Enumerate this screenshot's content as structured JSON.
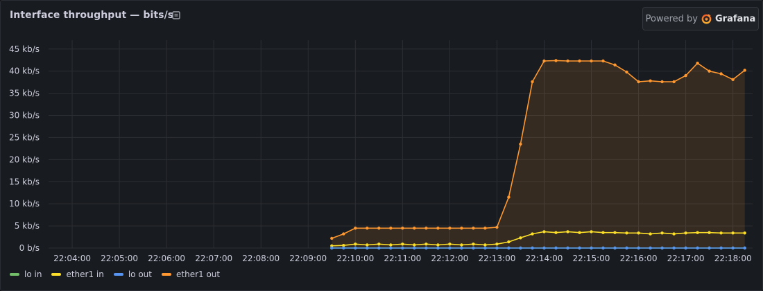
{
  "panel": {
    "title": "Interface throughput — bits/s",
    "badge_prefix": "Powered by",
    "badge_brand": "Grafana"
  },
  "colors": {
    "lo_in": "#73bf69",
    "ether1_in": "#fade2a",
    "lo_out": "#5794f2",
    "ether1_out": "#ff9830",
    "grid": "#2c2f35",
    "tick_text": "#ccccdc"
  },
  "chart_data": {
    "type": "line",
    "title": "Interface throughput — bits/s",
    "xlabel": "",
    "ylabel": "",
    "x_unit": "time",
    "x_range": [
      "22:03:30",
      "22:18:25"
    ],
    "ylim": [
      0,
      47
    ],
    "y_ticks": [
      "0 b/s",
      "5 kb/s",
      "10 kb/s",
      "15 kb/s",
      "20 kb/s",
      "25 kb/s",
      "30 kb/s",
      "35 kb/s",
      "40 kb/s",
      "45 kb/s"
    ],
    "x_ticks": [
      "22:04:00",
      "22:05:00",
      "22:06:00",
      "22:07:00",
      "22:08:00",
      "22:09:00",
      "22:10:00",
      "22:11:00",
      "22:12:00",
      "22:13:00",
      "22:14:00",
      "22:15:00",
      "22:16:00",
      "22:17:00",
      "22:18:00"
    ],
    "grid": true,
    "legend_position": "bottom-left",
    "x": [
      "22:09:30",
      "22:09:45",
      "22:10:00",
      "22:10:15",
      "22:10:30",
      "22:10:45",
      "22:11:00",
      "22:11:15",
      "22:11:30",
      "22:11:45",
      "22:12:00",
      "22:12:15",
      "22:12:30",
      "22:12:45",
      "22:13:00",
      "22:13:15",
      "22:13:30",
      "22:13:45",
      "22:14:00",
      "22:14:15",
      "22:14:30",
      "22:14:45",
      "22:15:00",
      "22:15:15",
      "22:15:30",
      "22:15:45",
      "22:16:00",
      "22:16:15",
      "22:16:30",
      "22:16:45",
      "22:17:00",
      "22:17:15",
      "22:17:30",
      "22:17:45",
      "22:18:00",
      "22:18:15"
    ],
    "series": [
      {
        "name": "lo in",
        "color_key": "lo_in",
        "values": [
          0,
          0,
          0,
          0,
          0,
          0,
          0,
          0,
          0,
          0,
          0,
          0,
          0,
          0,
          0,
          0,
          0,
          0,
          0,
          0,
          0,
          0,
          0,
          0,
          0,
          0,
          0,
          0,
          0,
          0,
          0,
          0,
          0,
          0,
          0,
          0
        ],
        "fill": false
      },
      {
        "name": "ether1 in",
        "color_key": "ether1_in",
        "values": [
          0.5,
          0.6,
          0.9,
          0.7,
          0.9,
          0.7,
          0.9,
          0.7,
          0.9,
          0.7,
          0.9,
          0.7,
          0.9,
          0.7,
          0.9,
          1.4,
          2.3,
          3.2,
          3.7,
          3.5,
          3.7,
          3.5,
          3.7,
          3.5,
          3.5,
          3.4,
          3.4,
          3.2,
          3.4,
          3.2,
          3.4,
          3.5,
          3.5,
          3.4,
          3.4,
          3.4
        ],
        "fill": false
      },
      {
        "name": "lo out",
        "color_key": "lo_out",
        "values": [
          0,
          0,
          0,
          0,
          0,
          0,
          0,
          0,
          0,
          0,
          0,
          0,
          0,
          0,
          0,
          0,
          0,
          0,
          0,
          0,
          0,
          0,
          0,
          0,
          0,
          0,
          0,
          0,
          0,
          0,
          0,
          0,
          0,
          0,
          0,
          0
        ],
        "fill": false
      },
      {
        "name": "ether1 out",
        "color_key": "ether1_out",
        "values": [
          2.2,
          3.2,
          4.5,
          4.5,
          4.5,
          4.5,
          4.5,
          4.5,
          4.5,
          4.5,
          4.5,
          4.5,
          4.5,
          4.5,
          4.7,
          11.5,
          23.5,
          37.6,
          42.3,
          42.4,
          42.3,
          42.3,
          42.3,
          42.3,
          41.4,
          39.8,
          37.6,
          37.8,
          37.6,
          37.6,
          39.0,
          41.8,
          40.0,
          39.4,
          38.1,
          40.2
        ],
        "fill": true
      }
    ]
  }
}
